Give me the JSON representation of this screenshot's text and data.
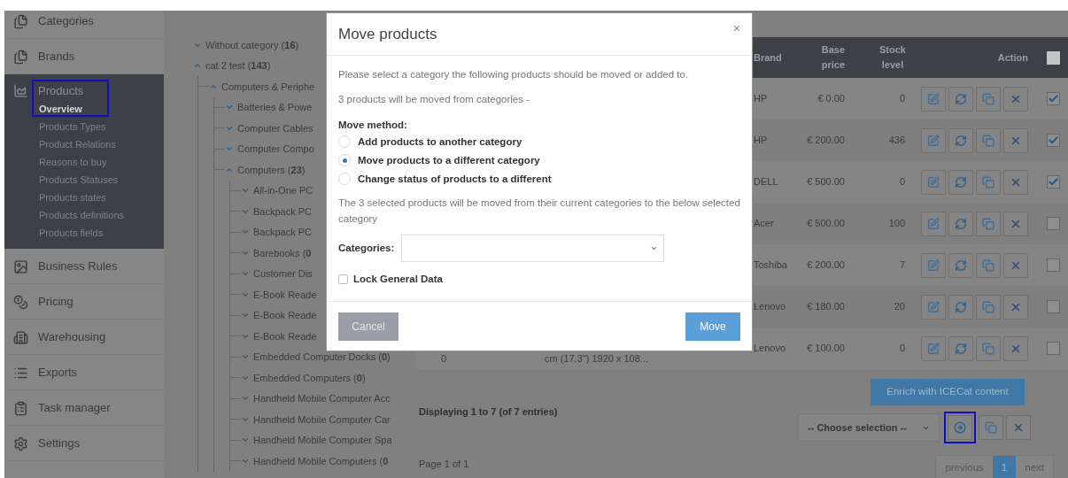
{
  "sidebar": {
    "items": [
      {
        "label": "Categories",
        "expanded": false,
        "highlighted": false
      },
      {
        "label": "Brands",
        "expanded": false,
        "highlighted": false
      },
      {
        "label": "Products",
        "expanded": true,
        "highlighted": true,
        "children": [
          {
            "label": "Overview",
            "selected": true
          },
          {
            "label": "Products Types",
            "selected": false
          },
          {
            "label": "Product Relations",
            "selected": false
          },
          {
            "label": "Reasons to buy",
            "selected": false
          },
          {
            "label": "Products Statuses",
            "selected": false
          },
          {
            "label": "Products states",
            "selected": false
          },
          {
            "label": "Products definitions",
            "selected": false
          },
          {
            "label": "Products fields",
            "selected": false
          }
        ]
      },
      {
        "label": "Business Rules",
        "expanded": false,
        "highlighted": false
      },
      {
        "label": "Pricing",
        "expanded": false,
        "highlighted": false
      },
      {
        "label": "Warehousing",
        "expanded": false,
        "highlighted": false
      },
      {
        "label": "Exports",
        "expanded": false,
        "highlighted": false
      },
      {
        "label": "Task manager",
        "expanded": false,
        "highlighted": false
      },
      {
        "label": "Settings",
        "expanded": false,
        "highlighted": false
      }
    ]
  },
  "category_tree": [
    {
      "label": "Without category (**16**)",
      "expanded": false
    },
    {
      "label": "cat 2 test (**143**)",
      "expanded": true,
      "children": [
        {
          "label": "Computers & Periphe",
          "expanded": true,
          "children": [
            {
              "label": "Batteries & Powe",
              "expanded": false
            },
            {
              "label": "Computer Cables",
              "expanded": false
            },
            {
              "label": "Computer Compo",
              "expanded": false
            },
            {
              "label": "Computers (**23**)",
              "expanded": true,
              "children": [
                {
                  "label": "All-in-One PC",
                  "expanded": false
                },
                {
                  "label": "Backpack PC",
                  "expanded": false
                },
                {
                  "label": "Backpack PC",
                  "expanded": false
                },
                {
                  "label": "Barebooks (**0**",
                  "expanded": false
                },
                {
                  "label": "Customer Dis",
                  "expanded": false
                },
                {
                  "label": "E-Book Reade",
                  "expanded": false
                },
                {
                  "label": "E-Book Reade",
                  "expanded": false
                },
                {
                  "label": "E-Book Reade",
                  "expanded": false
                },
                {
                  "label": "Embedded Computer Docks (**0**)",
                  "expanded": false
                },
                {
                  "label": "Embedded Computers (**0**)",
                  "expanded": false
                },
                {
                  "label": "Handheld Mobile Computer Acc",
                  "expanded": false
                },
                {
                  "label": "Handheld Mobile Computer Car",
                  "expanded": false
                },
                {
                  "label": "Handheld Mobile Computer Spa",
                  "expanded": false
                },
                {
                  "label": "Handheld Mobile Computers (**0**",
                  "expanded": false
                }
              ]
            }
          ]
        }
      ]
    }
  ],
  "table": {
    "columns": [
      "Brand",
      "Base price",
      "Stock level",
      "Action"
    ],
    "select_all": {
      "checked": false
    },
    "rows": [
      {
        "brand": "HP",
        "base_price": "€ 0.00",
        "stock_level": "0",
        "checked": true
      },
      {
        "brand": "HP",
        "base_price": "€ 200.00",
        "stock_level": "436",
        "checked": true
      },
      {
        "brand": "DELL",
        "base_price": "€ 500.00",
        "stock_level": "0",
        "checked": true
      },
      {
        "brand": "Acer",
        "base_price": "€ 500.00",
        "stock_level": "100",
        "checked": false
      },
      {
        "brand": "Toshiba",
        "base_price": "€ 200.00",
        "stock_level": "7",
        "checked": false
      },
      {
        "brand": "Lenovo",
        "base_price": "€ 180.00",
        "stock_level": "20",
        "checked": false
      },
      {
        "column_1": "0",
        "column_2": "cm (17.3\") 1920 x 108...",
        "brand": "Lenovo",
        "base_price": "€ 100.00",
        "stock_level": "0",
        "checked": false
      }
    ]
  },
  "enrich_button": "Enrich with ICECat content",
  "entries_info": "Displaying 1 to 7 (of 7 entries)",
  "bulk_action": {
    "value": "-- Choose selection --",
    "apply_highlighted": true
  },
  "page_info": "Page 1 of 1",
  "pagination": [
    {
      "label": "previous",
      "selected": false,
      "disabled": true
    },
    {
      "label": "1",
      "selected": true,
      "disabled": false
    },
    {
      "label": "next",
      "selected": false,
      "disabled": true
    }
  ],
  "modal": {
    "title": "Move products",
    "close": "×",
    "intro": "Please select a category the following products should be moved or added to.",
    "count_note": "3 products will be moved from categories -",
    "method_label": "Move method:",
    "methods": [
      {
        "label": "Add products to another category",
        "selected": false
      },
      {
        "label": "Move products to a different category",
        "selected": true
      },
      {
        "label": "Change status of products to a different",
        "selected": false
      }
    ],
    "description": "The 3 selected products will be moved from their current categories to the below selected category",
    "categories_label": "Categories:",
    "lock": {
      "label": "Lock General Data",
      "checked": false
    },
    "buttons": [
      {
        "label": "Cancel",
        "kind": "secondary"
      },
      {
        "label": "Move",
        "kind": "primary"
      }
    ]
  }
}
